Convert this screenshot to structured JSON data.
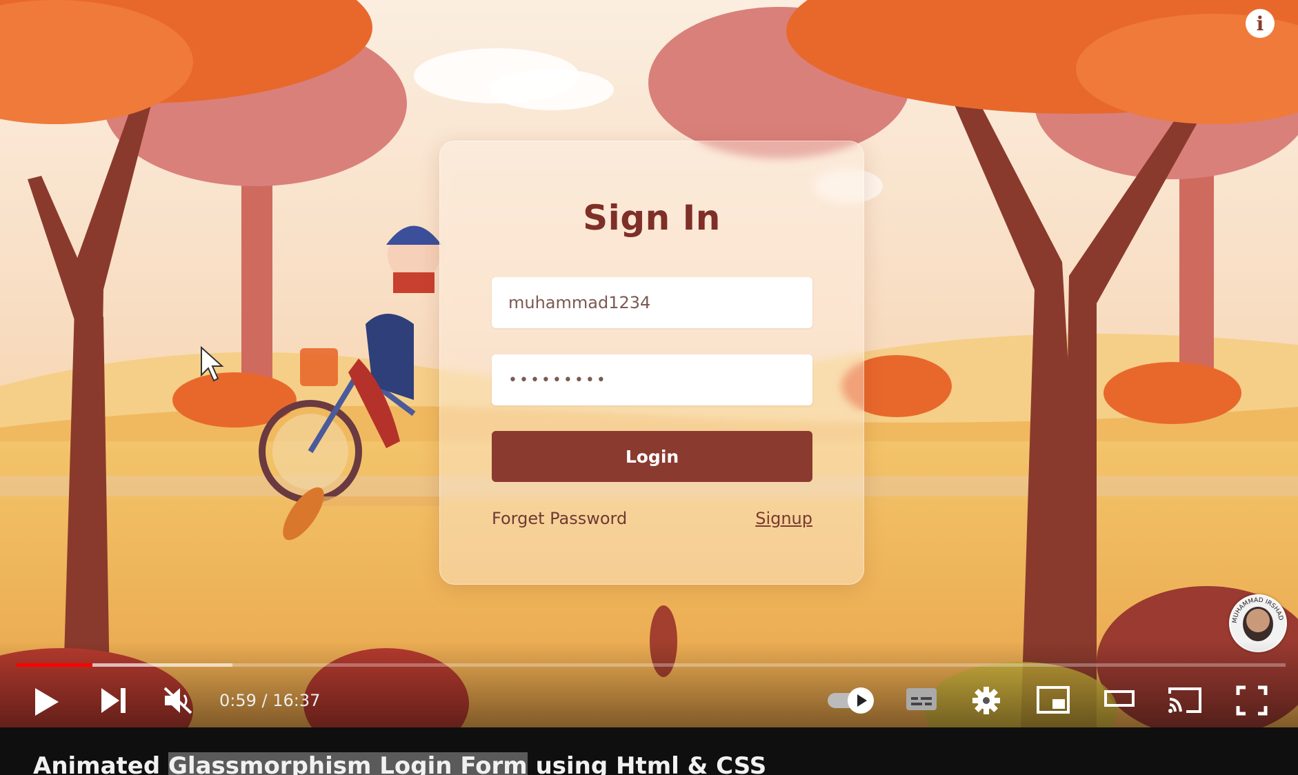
{
  "player": {
    "info_icon": "info-icon",
    "watermark_text": "MUHAMMAD IRSHAD"
  },
  "login_form": {
    "title": "Sign In",
    "username_value": "muhammad1234",
    "password_value": "•••••••••",
    "login_label": "Login",
    "forgot_label": "Forget Password",
    "signup_label": "Signup"
  },
  "controls": {
    "time_current": "0:59",
    "time_separator": " / ",
    "time_total": "16:37",
    "progress_played_fraction": 0.06,
    "progress_buffered_fraction": 0.17,
    "autoplay": true,
    "icons": [
      "play-icon",
      "next-icon",
      "mute-icon",
      "autoplay-toggle-icon",
      "subtitles-icon",
      "settings-icon",
      "miniplayer-icon",
      "theater-mode-icon",
      "cast-icon",
      "fullscreen-icon"
    ],
    "accent_color": "#ff0000"
  },
  "video": {
    "title_before": "Animated ",
    "title_highlight": "Glassmorphism Login Form",
    "title_after": " using Html & CSS"
  }
}
